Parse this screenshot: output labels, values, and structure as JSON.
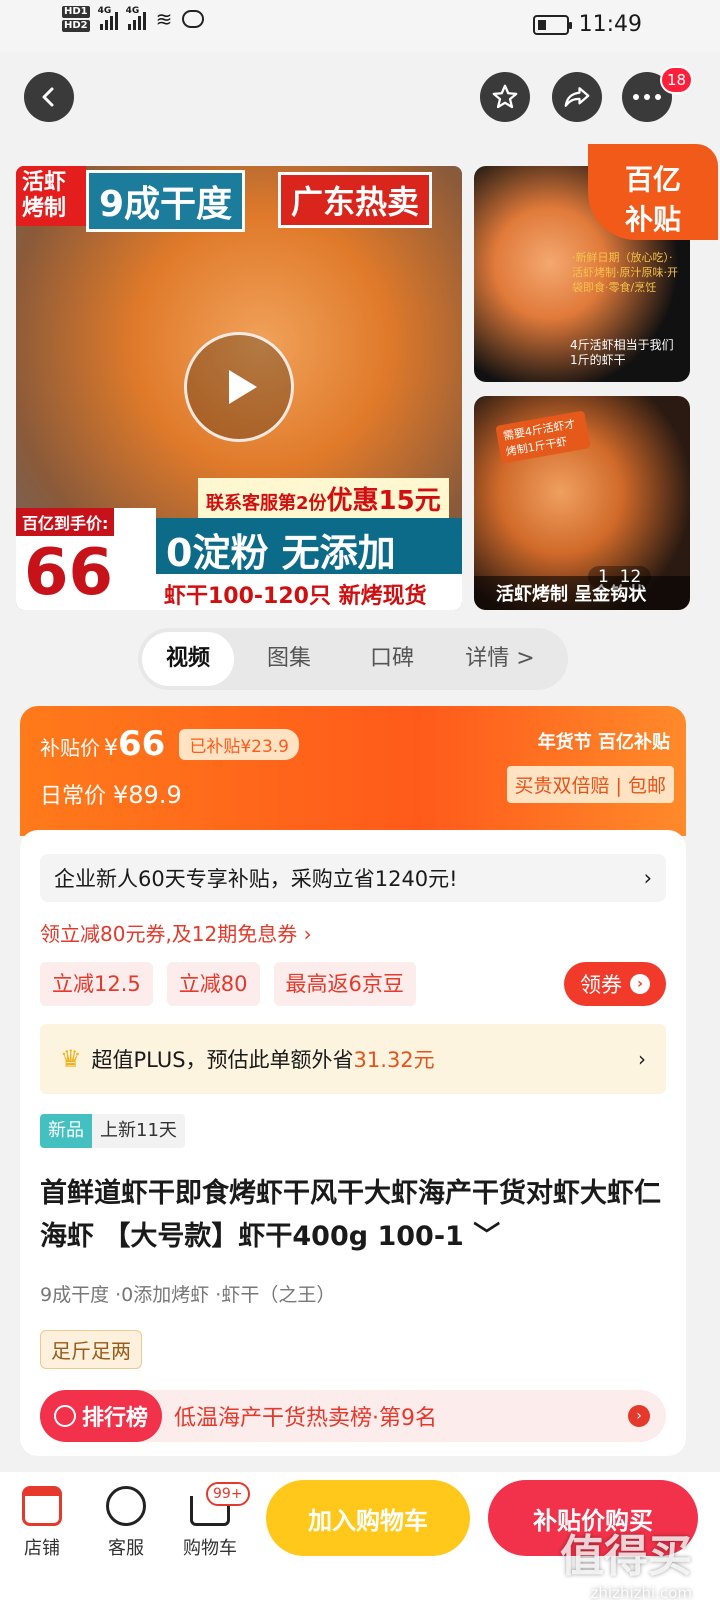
{
  "status_bar": {
    "hd1": "HD1",
    "hd2": "HD2",
    "net1": "4G",
    "net2": "4G",
    "time": "11:49"
  },
  "nav": {
    "more_badge": "18"
  },
  "media": {
    "tag_live": "活虾烤制",
    "tag_dry": "9成干度",
    "tag_hot": "广东热卖",
    "promo_pre": "联系客服第2份",
    "promo_main": "优惠15元",
    "price_label": "百亿到手价:",
    "price_value": "66",
    "slogan": "0淀粉 无添加",
    "bottom_line": "虾干100-120只 新烤现货",
    "thumb1_text": "·新鲜日期（放心吃）·活虾烤制·原汁原味·开袋即食·零食/烹饪",
    "thumb1_text2": "4斤活虾相当于我们1斤的虾干",
    "thumb2_tag": "需要4斤活虾才烤制1斤干虾",
    "thumb2_caption": "活虾烤制 呈金钩状",
    "counter_current": "1",
    "counter_total": "12",
    "badge_line1": "百亿",
    "badge_line2": "补贴"
  },
  "tabs": [
    "视频",
    "图集",
    "口碑",
    "详情 >"
  ],
  "price_card": {
    "subsidy_label": "补贴价",
    "currency": "¥",
    "subsidy_price": "66",
    "saved": "已补贴¥23.9",
    "daily_label": "日常价",
    "daily_price": "¥89.9",
    "brand": "年货节 百亿补贴",
    "guarantee": "买贵双倍赔 | 包邮"
  },
  "info": {
    "promo_line": "企业新人60天专享补贴，采购立省1240元!",
    "coupon_line": "领立减80元券,及12期免息券 ›",
    "chips": [
      "立减12.5",
      "立减80",
      "最高返6京豆"
    ],
    "get_coupon": "领券",
    "plus_prefix": "超值PLUS，预估此单额外省",
    "plus_amount": "31.32元",
    "new_tag": "新品",
    "new_days": "上新11天",
    "title": "首鲜道虾干即食烤虾干风干大虾海产干货对虾大虾仁海虾 【大号款】虾干400g 100-1 ﹀",
    "specs": "9成干度 ·0添加烤虾 ·虾干（之王）",
    "weight_tag": "足斤足两",
    "rank_label": "排行榜",
    "rank_text": "低温海产干货热卖榜·第9名"
  },
  "bottom_bar": {
    "shop": "店铺",
    "service": "客服",
    "cart": "购物车",
    "cart_badge": "99+",
    "add_cart": "加入购物车",
    "buy": "补贴价购买"
  },
  "watermark": {
    "main": "值得买",
    "site": "zhizhizhi.com"
  }
}
